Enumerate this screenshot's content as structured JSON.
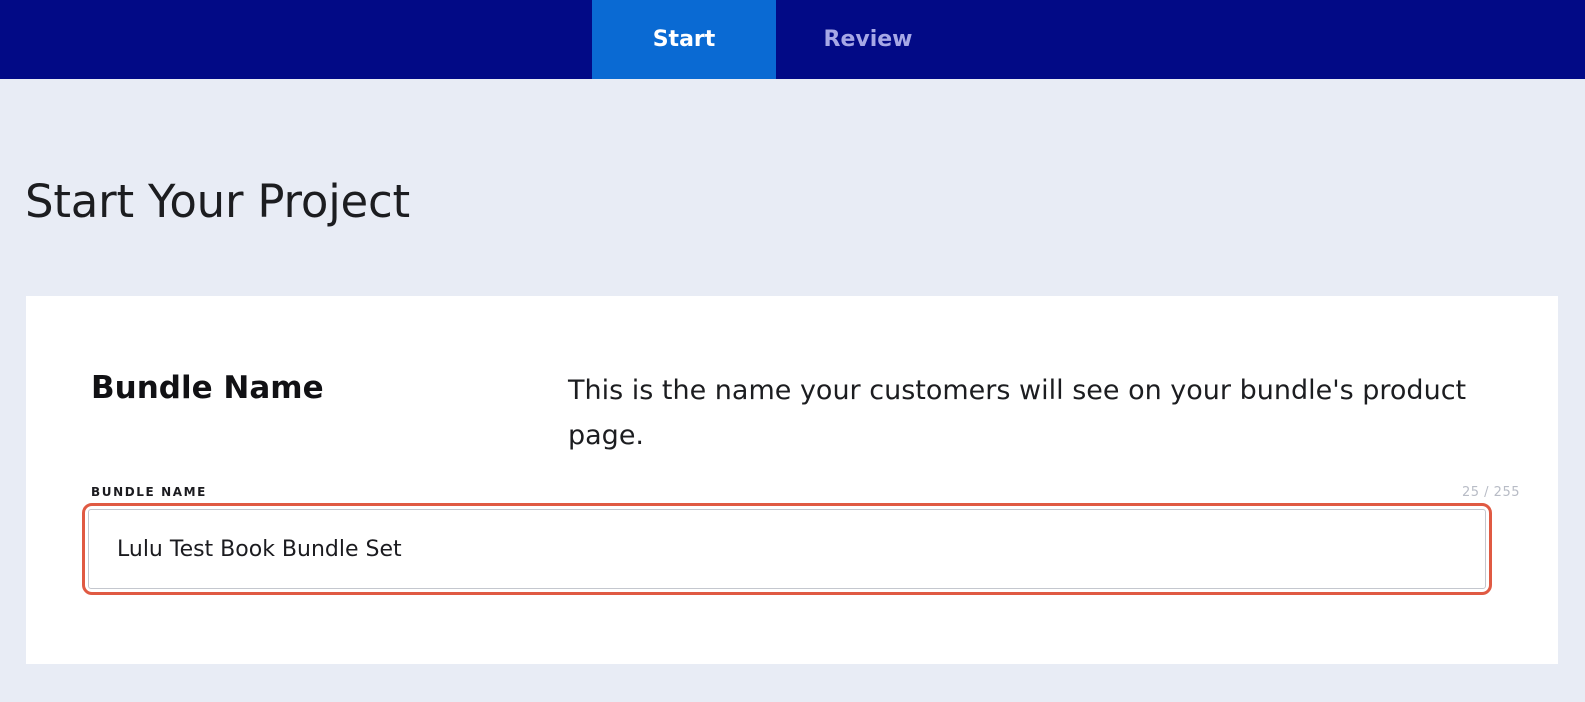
{
  "nav": {
    "tabs": [
      {
        "label": "Start",
        "active": true
      },
      {
        "label": "Review",
        "active": false
      }
    ],
    "background_color": "#020a86",
    "active_tab_color": "#0a6ad3"
  },
  "page": {
    "title": "Start Your Project"
  },
  "bundle_section": {
    "title": "Bundle Name",
    "description": "This is the name your customers will see on your bundle's product page.",
    "field": {
      "label": "BUNDLE NAME",
      "value": "Lulu Test Book Bundle Set",
      "char_count": "25 / 255"
    },
    "highlight_color": "#e05a43"
  }
}
